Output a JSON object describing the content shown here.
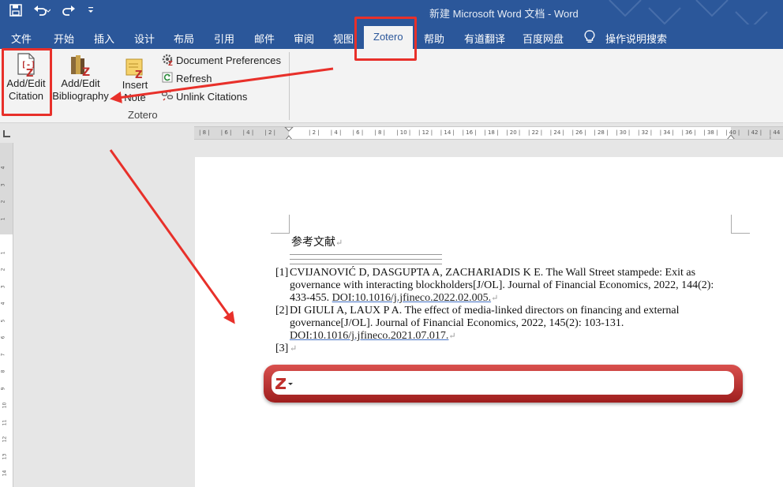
{
  "window": {
    "title": "新建 Microsoft Word 文档  -  Word",
    "qat": {
      "save_icon": "save-icon",
      "undo_icon": "undo-icon",
      "redo_icon": "redo-icon",
      "customize_icon": "customize-qat-icon"
    }
  },
  "tabs": [
    {
      "label": "文件"
    },
    {
      "label": "开始"
    },
    {
      "label": "插入"
    },
    {
      "label": "设计"
    },
    {
      "label": "布局"
    },
    {
      "label": "引用"
    },
    {
      "label": "邮件"
    },
    {
      "label": "审阅"
    },
    {
      "label": "视图"
    },
    {
      "label": "Zotero"
    },
    {
      "label": "帮助"
    },
    {
      "label": "有道翻译"
    },
    {
      "label": "百度网盘"
    },
    {
      "label": "操作说明搜索"
    }
  ],
  "ribbon": {
    "add_edit_citation": {
      "line1": "Add/Edit",
      "line2": "Citation"
    },
    "add_edit_bibliography": {
      "line1": "Add/Edit",
      "line2": "Bibliography"
    },
    "insert_note": {
      "line1": "Insert",
      "line2": "Note"
    },
    "document_preferences": "Document Preferences",
    "refresh": "Refresh",
    "unlink_citations": "Unlink Citations",
    "group_label": "Zotero"
  },
  "ruler": {
    "h_ticks": [
      "8",
      "6",
      "4",
      "2",
      "",
      "2",
      "4",
      "6",
      "8",
      "10",
      "12",
      "14",
      "16",
      "18",
      "20",
      "22",
      "24",
      "26",
      "28",
      "30",
      "32",
      "34",
      "36",
      "38",
      "40",
      "42",
      "44"
    ],
    "v_ticks": [
      "4",
      "3",
      "2",
      "1",
      "",
      "1",
      "2",
      "3",
      "4",
      "5",
      "6",
      "7",
      "8",
      "9",
      "10",
      "11",
      "12",
      "13",
      "14",
      "15"
    ]
  },
  "document": {
    "heading": "参考文献",
    "references": [
      {
        "num": "[1]",
        "text": " CVIJANOVIĆ D, DASGUPTA A, ZACHARIADIS K E. The Wall Street stampede: Exit as governance with interacting blockholders[J/OL]. Journal of Financial Economics, 2022, 144(2): 433-455. ",
        "doi": "DOI:10.1016/j.jfineco.2022.02.005."
      },
      {
        "num": "[2]",
        "text": "DI GIULI A, LAUX P A. The effect of media-linked directors on financing and external governance[J/OL]. Journal of Financial Economics, 2022, 145(2): 103-131. ",
        "doi": "DOI:10.1016/j.jfineco.2021.07.017."
      },
      {
        "num": "[3]",
        "text": "",
        "doi": ""
      }
    ],
    "paragraph_mark": "↵"
  },
  "zotero_bar": {
    "icon": "zotero-z-icon",
    "query": ""
  },
  "colors": {
    "word_blue": "#2b579a",
    "annotation_red": "#e8302a",
    "zotero_red": "#c0302c"
  }
}
